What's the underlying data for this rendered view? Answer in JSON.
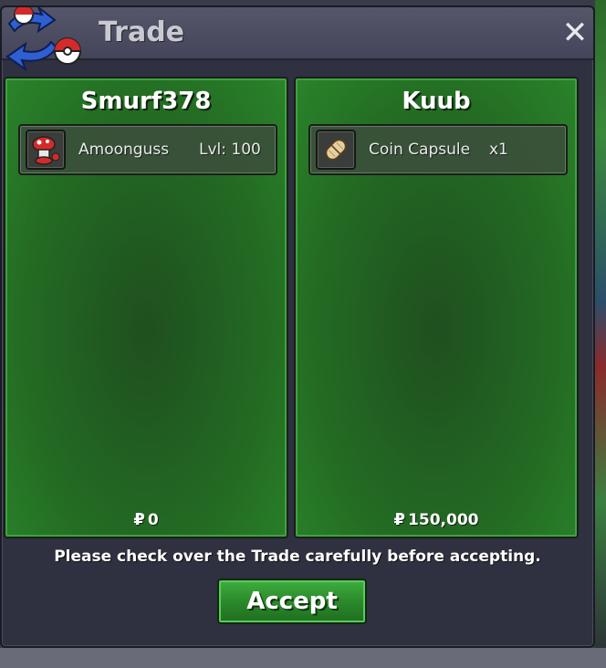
{
  "window": {
    "title": "Trade",
    "close_glyph": "✕"
  },
  "left_panel": {
    "player_name": "Smurf378",
    "items": [
      {
        "icon": "amoonguss-sprite-icon",
        "name": "Amoonguss",
        "extra": "Lvl: 100"
      }
    ],
    "currency_symbol": "₽",
    "money": "0"
  },
  "right_panel": {
    "player_name": "Kuub",
    "items": [
      {
        "icon": "coin-capsule-icon",
        "name": "Coin Capsule",
        "extra": "x1"
      }
    ],
    "currency_symbol": "₽",
    "money": "150,000"
  },
  "footer": {
    "notice": "Please check over the Trade carefully before accepting.",
    "accept_label": "Accept"
  },
  "colors": {
    "panel_green": "#236a23",
    "button_green": "#2b8a2b",
    "window_bg": "#2f3040"
  }
}
